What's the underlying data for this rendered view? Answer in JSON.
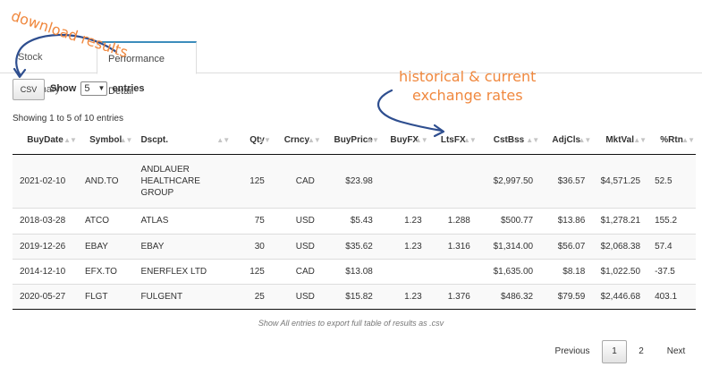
{
  "tabs": [
    {
      "label": "Stock Summary"
    },
    {
      "label": "Performance Detail"
    }
  ],
  "controls": {
    "csv_label": "CSV",
    "show_label": "Show",
    "show_value": "5",
    "entries_label": "entries"
  },
  "info": "Showing 1 to 5 of 10 entries",
  "table": {
    "headers": [
      "BuyDate",
      "Symbol",
      "Dscpt.",
      "Qty",
      "Crncy",
      "BuyPrice",
      "BuyFX",
      "LtsFX",
      "CstBss",
      "AdjCls",
      "MktVal",
      "%Rtn"
    ],
    "rows": [
      [
        "2021-02-10",
        "AND.TO",
        "ANDLAUER HEALTHCARE GROUP",
        "125",
        "CAD",
        "$23.98",
        "",
        "",
        "$2,997.50",
        "$36.57",
        "$4,571.25",
        "52.5"
      ],
      [
        "2018-03-28",
        "ATCO",
        "ATLAS",
        "75",
        "USD",
        "$5.43",
        "1.23",
        "1.288",
        "$500.77",
        "$13.86",
        "$1,278.21",
        "155.2"
      ],
      [
        "2019-12-26",
        "EBAY",
        "EBAY",
        "30",
        "USD",
        "$35.62",
        "1.23",
        "1.316",
        "$1,314.00",
        "$56.07",
        "$2,068.38",
        "57.4"
      ],
      [
        "2014-12-10",
        "EFX.TO",
        "ENERFLEX LTD",
        "125",
        "CAD",
        "$13.08",
        "",
        "",
        "$1,635.00",
        "$8.18",
        "$1,022.50",
        "-37.5"
      ],
      [
        "2020-05-27",
        "FLGT",
        "FULGENT",
        "25",
        "USD",
        "$15.82",
        "1.23",
        "1.376",
        "$486.32",
        "$79.59",
        "$2,446.68",
        "403.1"
      ]
    ]
  },
  "footnote": "Show All entries to export full table of results as .csv",
  "pagination": {
    "previous": "Previous",
    "pages": [
      "1",
      "2"
    ],
    "next": "Next"
  },
  "annotations": {
    "download": "download results",
    "historical_line1": "historical & current",
    "historical_line2": "exchange rates"
  },
  "colors": {
    "annotation": "#f0883e",
    "arrow": "#2e4e8f",
    "tab_accent": "#3c8dbc"
  }
}
